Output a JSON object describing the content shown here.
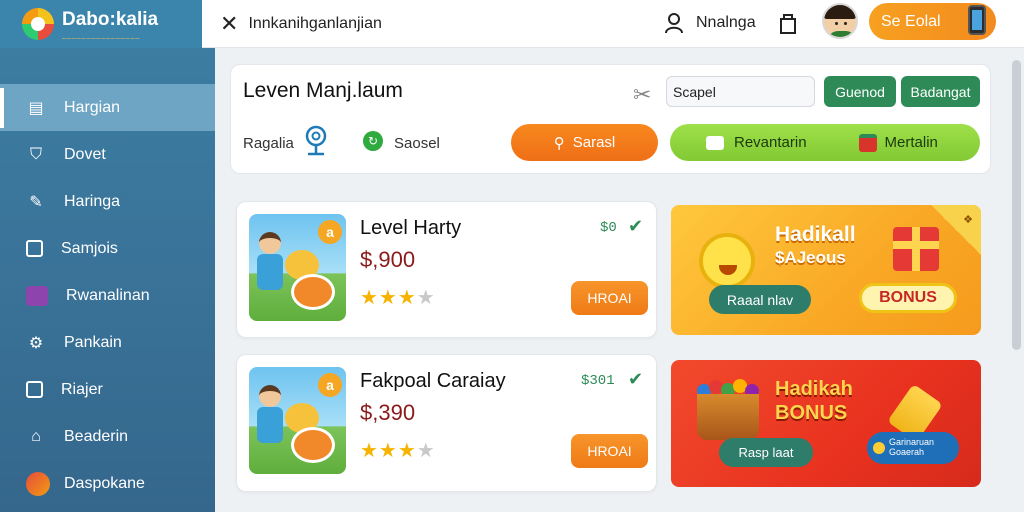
{
  "brand": {
    "name": "Dabo:kalia",
    "tagline": "________________"
  },
  "sidebar": {
    "items": [
      {
        "label": "Hargian",
        "icon": "document-icon",
        "active": true
      },
      {
        "label": "Dovet",
        "icon": "bag-icon"
      },
      {
        "label": "Haringa",
        "icon": "pencil-icon"
      },
      {
        "label": "Samjois",
        "icon": "camera-icon"
      },
      {
        "label": "Rwanalinan",
        "icon": "purple-box-icon"
      },
      {
        "label": "Pankain",
        "icon": "gear-icon"
      },
      {
        "label": "Riajer",
        "icon": "grid-icon"
      },
      {
        "label": "Beaderin",
        "icon": "home-icon"
      },
      {
        "label": "Daspokane",
        "icon": "colorful-logo-icon"
      }
    ]
  },
  "topbar": {
    "title": "Innkanihganlanjian",
    "user_name": "Nnalnga",
    "cta_label": "Se Eolal"
  },
  "panel": {
    "title": "Leven Manj.laum",
    "search_value": "Scapel",
    "btn1": "Guenod",
    "btn2": "Badangat",
    "row2_label1": "Ragalia",
    "row2_label2": "Saosel",
    "orange_btn": "Sarasl",
    "green_btn1": "Revantarin",
    "green_btn2": "Mertalin"
  },
  "cards": [
    {
      "title": "Level Harty",
      "price": "$,900",
      "small": "$0",
      "stars": 3,
      "button": "HROAI",
      "badge": "a"
    },
    {
      "title": "Fakpoal Caraiay",
      "price": "$,390",
      "small": "$301",
      "stars": 3,
      "button": "HROAI",
      "badge": "a"
    }
  ],
  "promo1": {
    "title": "Hadikall",
    "subtitle": "$AJeous",
    "pill": "Raaal nlav",
    "bonus": "BONUS",
    "corner": "❖"
  },
  "promo2": {
    "title": "Hadikah",
    "subtitle": "BONUS",
    "pill": "Rasp laat",
    "pill2_line1": "Garinaruan",
    "pill2_line2": "Goaerah"
  },
  "colors": {
    "accent_orange": "#f38b1e",
    "green": "#2e8b57",
    "sidebar": "#3a7399"
  }
}
